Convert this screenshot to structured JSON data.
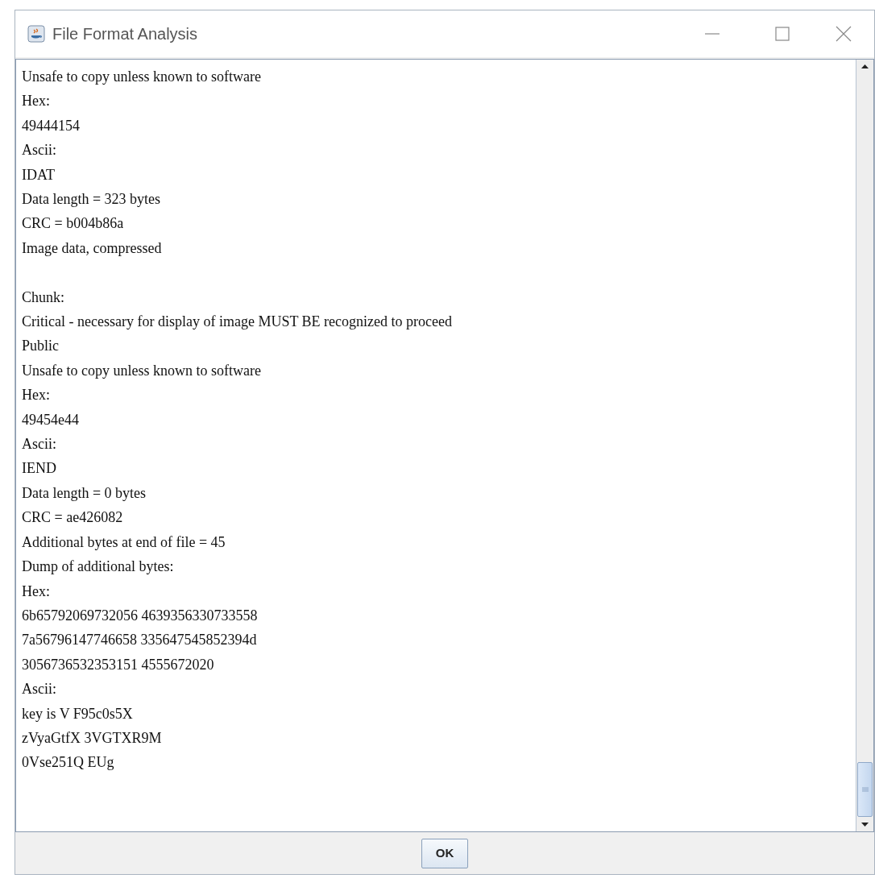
{
  "window": {
    "title": "File Format Analysis"
  },
  "output": {
    "blocks": [
      [
        "Unsafe to copy unless known to software",
        "Hex:",
        "49444154",
        "Ascii:",
        "IDAT",
        "Data length = 323 bytes",
        "CRC = b004b86a",
        "Image data, compressed"
      ],
      [
        "Chunk:",
        "Critical - necessary for display of image MUST BE recognized to proceed",
        "Public",
        "Unsafe to copy unless known to software",
        "Hex:",
        "49454e44",
        "Ascii:",
        "IEND",
        "Data length = 0 bytes",
        "CRC = ae426082",
        "Additional bytes at end of file = 45",
        "Dump of additional bytes:",
        "Hex:",
        "6b65792069732056 4639356330733558",
        "7a56796147746658 335647545852394d",
        "3056736532353151 4555672020",
        "Ascii:",
        "key is V F95c0s5X",
        "zVyaGtfX 3VGTXR9M",
        "0Vse251Q EUg"
      ]
    ]
  },
  "buttons": [
    "OK"
  ]
}
